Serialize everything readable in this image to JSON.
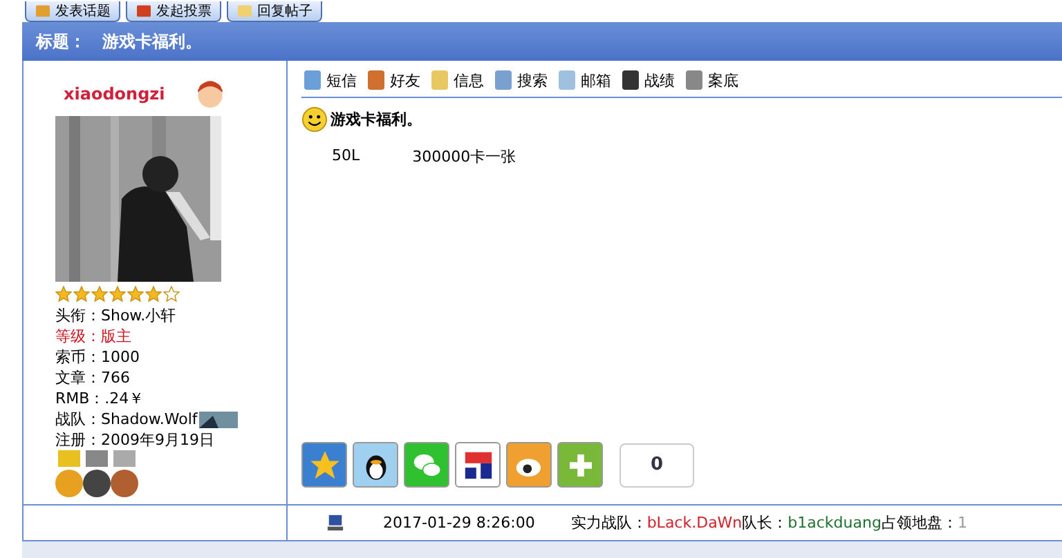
{
  "top_buttons": [
    {
      "label": "发表话题",
      "kind": "post"
    },
    {
      "label": "发起投票",
      "kind": "poll"
    },
    {
      "label": "回复帖子",
      "kind": "reply"
    }
  ],
  "title_bar": {
    "label": "标题：",
    "title": "游戏卡福利。"
  },
  "user": {
    "name": "xiaodongzi",
    "stars": 6,
    "info": [
      {
        "text": "头衔：Show.小轩",
        "highlight": false,
        "flag": false
      },
      {
        "text": "等级：版主",
        "highlight": true,
        "flag": false
      },
      {
        "text": "索币：1000",
        "highlight": false,
        "flag": false
      },
      {
        "text": "文章：766",
        "highlight": false,
        "flag": false
      },
      {
        "text": "RMB：.24￥",
        "highlight": false,
        "flag": false
      },
      {
        "text": "战队：Shadow.Wolf",
        "highlight": false,
        "flag": true
      },
      {
        "text": "注册：2009年9月19日",
        "highlight": false,
        "flag": false
      }
    ]
  },
  "toolbar": [
    {
      "label": "短信",
      "kind": "message"
    },
    {
      "label": "好友",
      "kind": "friends"
    },
    {
      "label": "信息",
      "kind": "info"
    },
    {
      "label": "搜索",
      "kind": "search"
    },
    {
      "label": "邮箱",
      "kind": "mail"
    },
    {
      "label": "战绩",
      "kind": "record"
    },
    {
      "label": "案底",
      "kind": "file"
    }
  ],
  "post": {
    "title": "游戏卡福利。",
    "body": [
      "50L",
      "300000卡一张"
    ]
  },
  "share": {
    "services": [
      {
        "kind": "qzone"
      },
      {
        "kind": "qq"
      },
      {
        "kind": "wechat"
      },
      {
        "kind": "renren"
      },
      {
        "kind": "weibo"
      },
      {
        "kind": "more"
      }
    ],
    "count": "0"
  },
  "footer": {
    "time": "2017-01-29 8:26:00",
    "parts": [
      {
        "text": "实力战队：",
        "color": "#000000"
      },
      {
        "text": "bLack.DaWn",
        "color": "#d0202a"
      },
      {
        "text": "队长：",
        "color": "#000000"
      },
      {
        "text": "b1ackduang",
        "color": "#207030"
      },
      {
        "text": "占领地盘：",
        "color": "#000000"
      },
      {
        "text": "1",
        "color": "#999999"
      }
    ]
  }
}
